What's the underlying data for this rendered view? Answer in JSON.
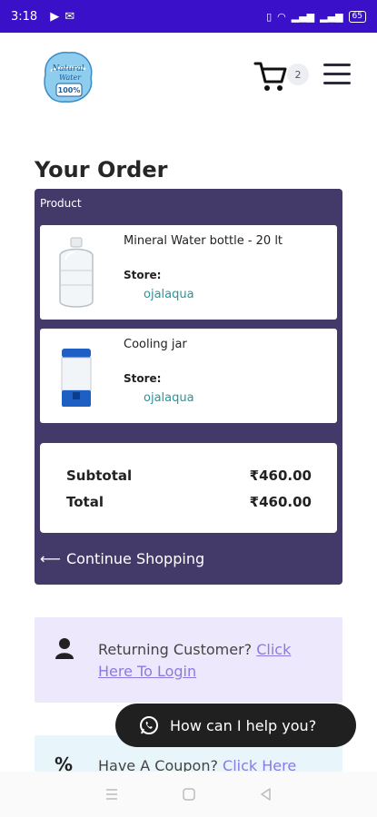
{
  "status_bar": {
    "time": "3:18",
    "battery": "65"
  },
  "header": {
    "logo_text": "Natural Water 100%",
    "cart_count": "2"
  },
  "order": {
    "title": "Your Order",
    "product_header": "Product",
    "items": [
      {
        "name": "Mineral Water bottle - 20 lt",
        "store_label": "Store:",
        "store": "ojalaqua",
        "icon": "water-bottle-icon"
      },
      {
        "name": "Cooling jar",
        "store_label": "Store:",
        "store": "ojalaqua",
        "icon": "cooling-jar-icon"
      }
    ],
    "subtotal_label": "Subtotal",
    "subtotal_value": "₹460.00",
    "total_label": "Total",
    "total_value": "₹460.00",
    "continue_label": "Continue Shopping"
  },
  "returning": {
    "text": "Returning Customer? ",
    "link": "Click Here To Login"
  },
  "coupon": {
    "text": "Have A Coupon? ",
    "link": "Click Here"
  },
  "chat": {
    "label": "How can I help you?"
  },
  "colors": {
    "status_bar": "#3a10c9",
    "order_box": "#433a6a",
    "store_link": "#1a9ba3",
    "link": "#8b7ae0",
    "returning_bg": "#ede8fb",
    "coupon_bg": "#e8f6fb",
    "chat_bg": "#202020"
  }
}
